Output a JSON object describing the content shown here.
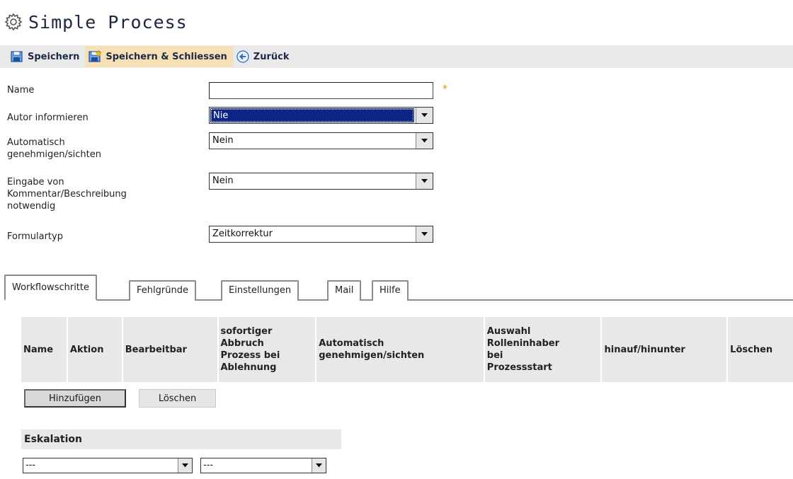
{
  "header": {
    "title": "Simple Process",
    "icon": "gear-icon"
  },
  "toolbar": {
    "save_label": "Speichern",
    "save_close_label": "Speichern & Schliessen",
    "back_label": "Zurück"
  },
  "form": {
    "name_label": "Name",
    "name_value": "",
    "required_marker": "*",
    "notify_author_label": "Autor informieren",
    "notify_author_value": "Nie",
    "auto_approve_label_line1": "Automatisch",
    "auto_approve_label_line2": "genehmigen/sichten",
    "auto_approve_value": "Nein",
    "comment_label_line1": "Eingabe von",
    "comment_label_line2": "Kommentar/Beschreibung",
    "comment_label_line3": "notwendig",
    "comment_value": "Nein",
    "form_type_label": "Formulartyp",
    "form_type_value": "Zeitkorrektur"
  },
  "tabs": [
    {
      "label": "Workflowschritte",
      "active": true
    },
    {
      "label": "Fehlgründe",
      "active": false
    },
    {
      "label": "Einstellungen",
      "active": false
    },
    {
      "label": "Mail",
      "active": false
    },
    {
      "label": "Hilfe",
      "active": false
    }
  ],
  "grid": {
    "columns": [
      [
        "Name"
      ],
      [
        "Aktion"
      ],
      [
        "Bearbeitbar"
      ],
      [
        "sofortiger",
        "Abbruch",
        "Prozess bei",
        "Ablehnung"
      ],
      [
        "Automatisch",
        "genehmigen/sichten"
      ],
      [
        "Auswahl",
        "Rolleninhaber",
        "bei",
        "Prozessstart"
      ],
      [
        "hinauf/hinunter"
      ],
      [
        "Löschen"
      ]
    ],
    "add_button": "Hinzufügen",
    "delete_button": "Löschen"
  },
  "escalation": {
    "title": "Eskalation",
    "select1_value": "---",
    "select2_value": "---"
  },
  "colors": {
    "accent_orange": "#f08a00",
    "selection_blue": "#0b2486",
    "toolbar_bg": "#eaeaea"
  }
}
